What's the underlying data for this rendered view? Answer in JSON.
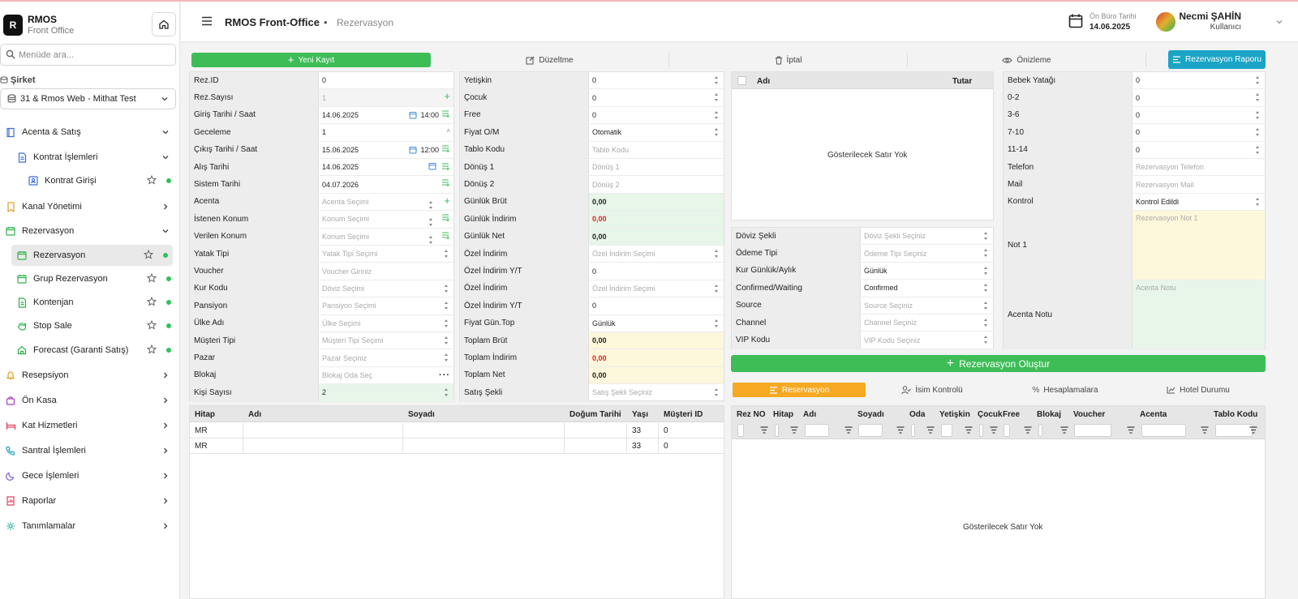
{
  "brand": {
    "logo": "R",
    "name": "RMOS",
    "sub": "Front Office"
  },
  "search": {
    "placeholder": "Menüde ara..."
  },
  "company": {
    "label": "Şirket",
    "value": "31 & Rmos Web - Mithat Test"
  },
  "nav": [
    {
      "label": "Acenta & Satış",
      "icon": "book-icon",
      "color": "#3b6fd8",
      "expanded": true
    },
    {
      "label": "Kontrat İşlemleri",
      "icon": "document-icon",
      "color": "#3b6fd8",
      "expanded": true
    },
    {
      "label": "Kontrat Girişi",
      "icon": "form-icon",
      "color": "#3b6fd8"
    },
    {
      "label": "Kanal Yönetimi",
      "icon": "bookmark-icon",
      "color": "#e0a020"
    },
    {
      "label": "Rezervasyon",
      "icon": "calendar-icon",
      "color": "#2eb24a",
      "expanded": true
    },
    {
      "label": "Rezervasyon",
      "icon": "calendar-icon",
      "color": "#2eb24a"
    },
    {
      "label": "Grup Rezervasyon",
      "icon": "calendar-icon",
      "color": "#2eb24a"
    },
    {
      "label": "Kontenjan",
      "icon": "document-icon",
      "color": "#2eb24a"
    },
    {
      "label": "Stop Sale",
      "icon": "hand-icon",
      "color": "#2eb24a"
    },
    {
      "label": "Forecast (Garanti Satış)",
      "icon": "home-icon",
      "color": "#2eb24a"
    },
    {
      "label": "Resepsiyon",
      "icon": "bell-icon",
      "color": "#e0a020"
    },
    {
      "label": "Ön Kasa",
      "icon": "bag-icon",
      "color": "#a040c8"
    },
    {
      "label": "Kat Hizmetleri",
      "icon": "bed-icon",
      "color": "#e04060"
    },
    {
      "label": "Santral İşlemleri",
      "icon": "phone-icon",
      "color": "#20a0c0"
    },
    {
      "label": "Gece İşlemleri",
      "icon": "moon-icon",
      "color": "#8060d0"
    },
    {
      "label": "Raporlar",
      "icon": "chart-icon",
      "color": "#e04060"
    },
    {
      "label": "Tanımlamalar",
      "icon": "gear-icon",
      "color": "#20b0a0"
    }
  ],
  "header": {
    "title": "RMOS Front-Office",
    "sep": "•",
    "crumb": "Rezervasyon",
    "office_date_label": "Ön Büro Tarihi",
    "office_date": "14.06.2025",
    "user_name": "Necmi ŞAHİN",
    "user_role": "Kullanıcı"
  },
  "toolbar": {
    "new": "Yeni Kayıt",
    "edit": "Düzeltme",
    "cancel": "İptal",
    "preview": "Önizleme",
    "report": "Rezervasyon Raporu"
  },
  "form1": [
    {
      "label": "Rez.ID",
      "value": "0"
    },
    {
      "label": "Rez.Sayısı",
      "value": "1"
    },
    {
      "label": "Giriş Tarihi / Saat",
      "value": "14.06.2025",
      "time": "14:00"
    },
    {
      "label": "Geceleme",
      "value": "1"
    },
    {
      "label": "Çıkış Tarihi / Saat",
      "value": "15.06.2025",
      "time": "12:00"
    },
    {
      "label": "Alış Tarihi",
      "value": "14.06.2025"
    },
    {
      "label": "Sistem Tarihi",
      "value": "04.07.2026"
    },
    {
      "label": "Acenta",
      "placeholder": "Acenta Seçimi"
    },
    {
      "label": "İstenen Konum",
      "placeholder": "Konum Seçimi"
    },
    {
      "label": "Verilen Konum",
      "placeholder": "Konum Seçimi"
    },
    {
      "label": "Yatak Tipi",
      "placeholder": "Yatak Tipi Seçimi"
    },
    {
      "label": "Voucher",
      "placeholder": "Voucher Giriniz"
    },
    {
      "label": "Kur Kodu",
      "placeholder": "Döviz Seçimi"
    },
    {
      "label": "Pansiyon",
      "placeholder": "Pansiyon Seçimi"
    },
    {
      "label": "Ülke Adı",
      "placeholder": "Ülke Seçimi"
    },
    {
      "label": "Müşteri Tipi",
      "placeholder": "Müşteri Tipi Seçimi"
    },
    {
      "label": "Pazar",
      "placeholder": "Pazar Seçiniz"
    },
    {
      "label": "Blokaj",
      "placeholder": "Blokaj Oda Seç"
    },
    {
      "label": "Kişi Sayısı",
      "value": "2"
    }
  ],
  "form2": [
    {
      "label": "Yetişkin",
      "value": "0"
    },
    {
      "label": "Çocuk",
      "value": "0"
    },
    {
      "label": "Free",
      "value": "0"
    },
    {
      "label": "Fiyat O/M",
      "value": "Otomatik"
    },
    {
      "label": "Tablo Kodu",
      "placeholder": "Tablo Kodu"
    },
    {
      "label": "Dönüş 1",
      "placeholder": "Dönüş 1"
    },
    {
      "label": "Dönüş 2",
      "placeholder": "Dönüş 2"
    },
    {
      "label": "Günlük Brüt",
      "value": "0,00"
    },
    {
      "label": "Günlük İndirim",
      "value": "0,00"
    },
    {
      "label": "Günlük Net",
      "value": "0,00"
    },
    {
      "label": "Özel İndirim",
      "placeholder": "Özel İndirim Seçimi"
    },
    {
      "label": "Özel İndirim Y/T",
      "value": "0"
    },
    {
      "label": "Özel İndirim",
      "placeholder": "Özel İndirim Seçimi"
    },
    {
      "label": "Özel İndirim Y/T",
      "value": "0"
    },
    {
      "label": "Fiyat Gün.Top",
      "value": "Günlük"
    },
    {
      "label": "Toplam Brüt",
      "value": "0,00"
    },
    {
      "label": "Toplam İndirim",
      "value": "0,00"
    },
    {
      "label": "Toplam Net",
      "value": "0,00"
    },
    {
      "label": "Satış Şekli",
      "placeholder": "Satış Şekli Seçiniz"
    }
  ],
  "price_table": {
    "col_name": "Adı",
    "col_amount": "Tutar",
    "empty": "Gösterilecek Satır Yok"
  },
  "form3": [
    {
      "label": "Döviz Şekli",
      "placeholder": "Döviz Şekli Seçiniz"
    },
    {
      "label": "Ödeme Tipi",
      "placeholder": "Ödeme Tipi Seçiniz"
    },
    {
      "label": "Kur Günlük/Aylık",
      "value": "Günlük"
    },
    {
      "label": "Confirmed/Waiting",
      "value": "Confirmed"
    },
    {
      "label": "Source",
      "placeholder": "Source Seçiniz"
    },
    {
      "label": "Channel",
      "placeholder": "Channel Seçiniz"
    },
    {
      "label": "VIP Kodu",
      "placeholder": "VIP Kodu Seçiniz"
    }
  ],
  "form4": [
    {
      "label": "Bebek Yatağı",
      "value": "0"
    },
    {
      "label": "0-2",
      "value": "0"
    },
    {
      "label": "3-6",
      "value": "0"
    },
    {
      "label": "7-10",
      "value": "0"
    },
    {
      "label": "11-14",
      "value": "0"
    },
    {
      "label": "Telefon",
      "placeholder": "Rezervasyon Telefon"
    },
    {
      "label": "Mail",
      "placeholder": "Rezervasyon Mail"
    },
    {
      "label": "Kontrol",
      "value": "Kontrol Edildi"
    },
    {
      "label": "Not 1",
      "placeholder": "Rezervasyon Not 1"
    },
    {
      "label": "Acenta Notu",
      "placeholder": "Acenta Notu"
    }
  ],
  "create_button": "Rezervasyon Oluştur",
  "guest_table": {
    "headers": [
      "Hitap",
      "Adı",
      "Soyadı",
      "Doğum Tarihi",
      "Yaşı",
      "Müşteri ID"
    ],
    "rows": [
      [
        "MR",
        "",
        "",
        "",
        "33",
        "0"
      ],
      [
        "MR",
        "",
        "",
        "",
        "33",
        "0"
      ]
    ]
  },
  "res_tabs": [
    "Reservasyon",
    "İsim Kontrolü",
    "Hesaplamalara",
    "Hotel Durumu"
  ],
  "res_table": {
    "headers": [
      "Rez NO",
      "Hitap",
      "Adı",
      "Soyadı",
      "Oda",
      "Yetişkin",
      "Çocuk",
      "Free",
      "Blokaj",
      "Voucher",
      "Acenta",
      "Tablo Kodu"
    ],
    "empty": "Gösterilecek Satır Yok"
  }
}
